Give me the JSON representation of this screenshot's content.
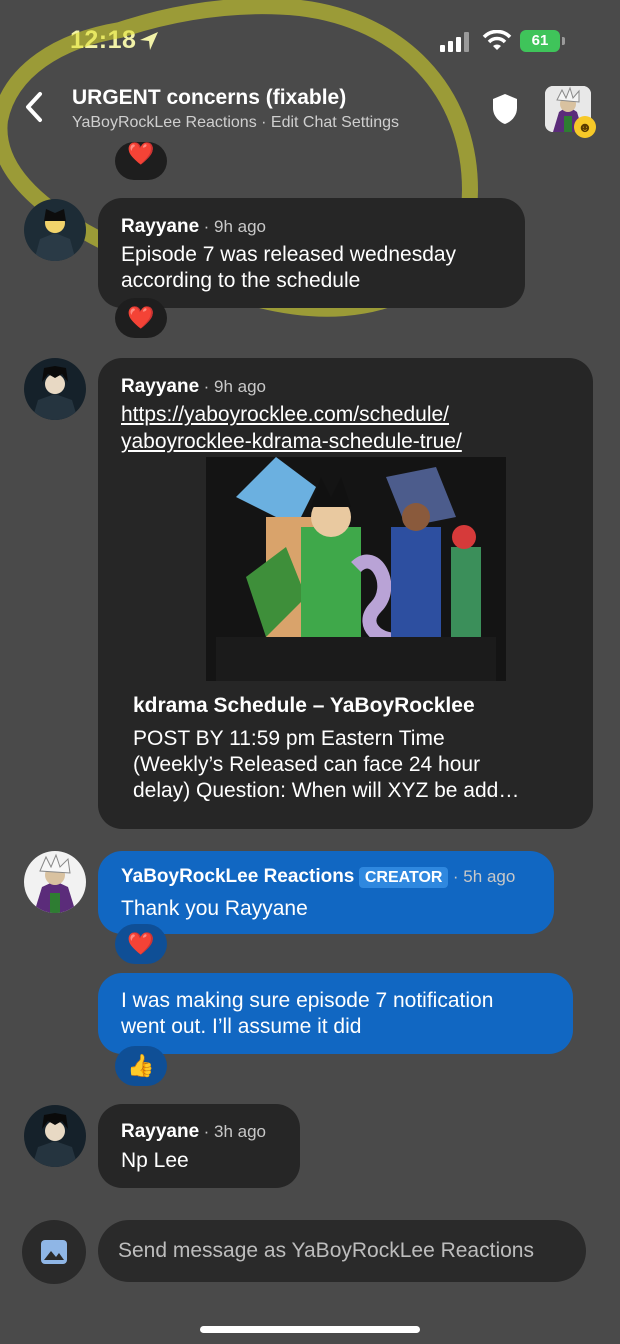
{
  "status": {
    "time": "12:18",
    "battery": "61"
  },
  "header": {
    "title": "URGENT concerns (fixable)",
    "subtitle": "YaBoyRockLee Reactions · Edit Chat Settings"
  },
  "messages": [
    {
      "author": "Rayyane",
      "ago": "· 9h ago",
      "text_1": "Episode 7 was released wednesday",
      "text_2": "according to the schedule",
      "reaction": "❤️"
    },
    {
      "author": "Rayyane",
      "ago": "· 9h ago",
      "link_1": "https://yaboyrocklee.com/schedule/",
      "link_2": "yaboyrocklee-kdrama-schedule-true/",
      "preview_title": "kdrama Schedule – YaBoyRocklee",
      "preview_desc_1": "POST BY 11:59 pm Eastern Time",
      "preview_desc_2": "(Weekly’s Released can face 24 hour",
      "preview_desc_3": "delay) Question: When will XYZ be add…"
    },
    {
      "author": "YaBoyRockLee Reactions",
      "badge": "CREATOR",
      "ago": "· 5h ago",
      "text": "Thank you Rayyane",
      "reaction": "❤️"
    },
    {
      "text_1": "I was making sure episode 7 notification",
      "text_2": "went out. I’ll assume it did",
      "reaction": "👍"
    },
    {
      "author": "Rayyane",
      "ago": "· 3h ago",
      "text": "Np Lee"
    }
  ],
  "top_reaction": "❤️",
  "composer": {
    "placeholder": "Send message as YaBoyRockLee Reactions"
  },
  "icons": [
    "location-arrow-icon",
    "signal-icon",
    "wifi-icon",
    "battery-icon",
    "back-chevron-icon",
    "shield-icon",
    "image-icon"
  ],
  "colors": {
    "background": "#4a4a4a",
    "bubble_dark": "#262626",
    "bubble_blue": "#1167c2",
    "creator_badge": "#2f88df",
    "battery": "#3fc45a"
  }
}
